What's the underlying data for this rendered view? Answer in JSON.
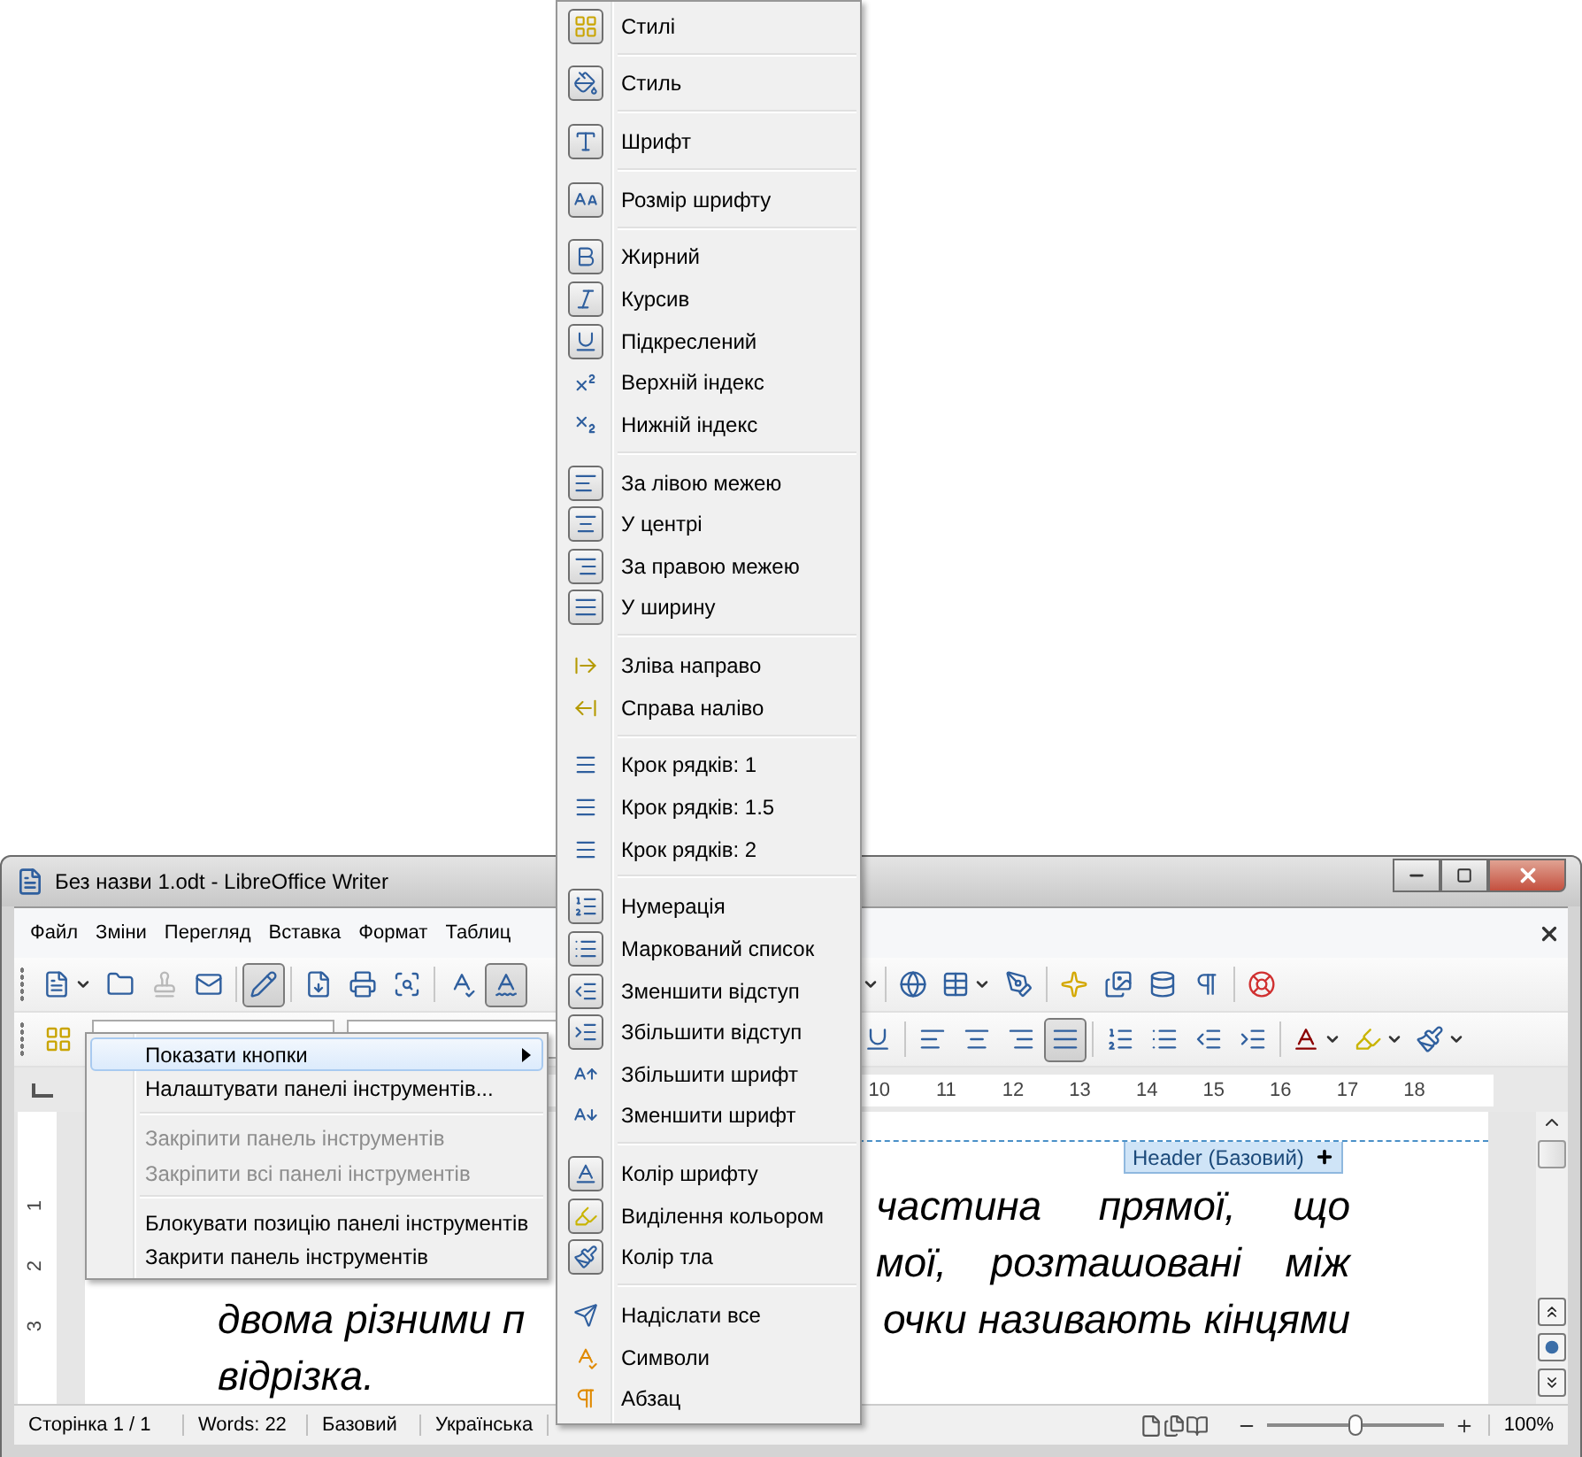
{
  "window": {
    "title": "Без назви 1.odt - LibreOffice Writer"
  },
  "menu_bar": [
    "Файл",
    "Зміни",
    "Перегляд",
    "Вставка",
    "Формат",
    "Таблиц"
  ],
  "standard_toolbar": {
    "left": [
      {
        "pressed": false,
        "dropdown": true,
        "disabled": false
      },
      {
        "pressed": false,
        "dropdown": false,
        "disabled": false
      },
      {
        "pressed": false,
        "dropdown": false,
        "disabled": true
      },
      {
        "pressed": false,
        "dropdown": false,
        "disabled": false
      },
      {
        "pressed": true,
        "dropdown": false,
        "disabled": false
      },
      {
        "pressed": false,
        "dropdown": false,
        "disabled": false
      },
      {
        "pressed": false,
        "dropdown": false,
        "disabled": false
      },
      {
        "pressed": false,
        "dropdown": false,
        "disabled": false
      },
      {
        "pressed": false,
        "dropdown": false,
        "disabled": false
      },
      {
        "pressed": true,
        "dropdown": false,
        "disabled": false
      }
    ],
    "right": [
      {
        "pressed": false,
        "dropdown": false,
        "disabled": false
      },
      {
        "pressed": false,
        "dropdown": true,
        "disabled": false
      },
      {
        "pressed": false,
        "dropdown": false,
        "disabled": false
      },
      {
        "pressed": false,
        "dropdown": false,
        "disabled": false
      },
      {
        "pressed": false,
        "dropdown": false,
        "disabled": false
      },
      {
        "pressed": false,
        "dropdown": false,
        "disabled": false
      },
      {
        "pressed": false,
        "dropdown": false,
        "disabled": false
      },
      {
        "pressed": false,
        "dropdown": false,
        "disabled": false
      }
    ]
  },
  "formatting_toolbar": {
    "right": [
      {
        "pressed": false,
        "dropdown": false
      },
      {
        "pressed": false,
        "dropdown": false
      },
      {
        "pressed": false,
        "dropdown": false
      },
      {
        "pressed": false,
        "dropdown": false
      },
      {
        "pressed": true,
        "dropdown": false
      },
      {
        "pressed": false,
        "dropdown": false
      },
      {
        "pressed": false,
        "dropdown": false
      },
      {
        "pressed": false,
        "dropdown": false
      },
      {
        "pressed": false,
        "dropdown": false
      },
      {
        "pressed": false,
        "dropdown": true
      },
      {
        "pressed": false,
        "dropdown": true
      },
      {
        "pressed": false,
        "dropdown": true
      }
    ]
  },
  "ruler": [
    "10",
    "11",
    "12",
    "13",
    "14",
    "15",
    "16",
    "17",
    "18"
  ],
  "vertical_ruler": [
    "1",
    "2",
    "3"
  ],
  "header_tag": "Header (Базовий)",
  "document_lines": [
    {
      "right": [
        "частина",
        "прямої,",
        "що"
      ]
    },
    {
      "right": [
        "мої,",
        "розташовані",
        "між"
      ]
    },
    {
      "left": "двома різними п",
      "right": [
        "очки називають кінцями"
      ]
    },
    {
      "left": "відрізка."
    }
  ],
  "status_bar": {
    "page": "Сторінка 1 / 1",
    "words": "Words: 22",
    "style": "Базовий",
    "language": "Українська",
    "zoom_slider": {
      "level": 0.5
    },
    "zoom": "100%"
  },
  "context_menu": {
    "groups": [
      {
        "items": [
          {
            "label": "Показати кнопки",
            "selected": true,
            "disabled": false,
            "submenu": true
          },
          {
            "label": "Налаштувати панелі інструментів...",
            "selected": false,
            "disabled": false,
            "submenu": false
          }
        ]
      },
      {
        "items": [
          {
            "label": "Закріпити панель інструментів",
            "selected": false,
            "disabled": true,
            "submenu": false
          },
          {
            "label": "Закріпити всі панелі інструментів",
            "selected": false,
            "disabled": true,
            "submenu": false
          }
        ]
      },
      {
        "items": [
          {
            "label": "Блокувати позицію панелі інструментів",
            "selected": false,
            "disabled": false,
            "submenu": false
          },
          {
            "label": "Закрити панель інструментів",
            "selected": false,
            "disabled": false,
            "submenu": false
          }
        ]
      }
    ]
  },
  "buttons_menu": {
    "groups": [
      {
        "items": [
          {
            "label": "Стилі",
            "checked": true
          }
        ]
      },
      {
        "items": [
          {
            "label": "Стиль",
            "checked": true
          }
        ]
      },
      {
        "items": [
          {
            "label": "Шрифт",
            "checked": true
          }
        ]
      },
      {
        "items": [
          {
            "label": "Розмір шрифту",
            "checked": true
          }
        ]
      },
      {
        "items": [
          {
            "label": "Жирний",
            "checked": true
          },
          {
            "label": "Курсив",
            "checked": true
          },
          {
            "label": "Підкреслений",
            "checked": true
          },
          {
            "label": "Верхній індекс",
            "checked": false
          },
          {
            "label": "Нижній індекс",
            "checked": false
          }
        ]
      },
      {
        "items": [
          {
            "label": "За лівою межею",
            "checked": true
          },
          {
            "label": "У центрі",
            "checked": true
          },
          {
            "label": "За правою межею",
            "checked": true
          },
          {
            "label": "У ширину",
            "checked": true
          }
        ]
      },
      {
        "items": [
          {
            "label": "Зліва направо",
            "checked": false
          },
          {
            "label": "Справа наліво",
            "checked": false
          }
        ]
      },
      {
        "items": [
          {
            "label": "Крок рядків: 1",
            "checked": false
          },
          {
            "label": "Крок рядків: 1.5",
            "checked": false
          },
          {
            "label": "Крок рядків: 2",
            "checked": false
          }
        ]
      },
      {
        "items": [
          {
            "label": "Нумерація",
            "checked": true
          },
          {
            "label": "Маркований список",
            "checked": true
          },
          {
            "label": "Зменшити відступ",
            "checked": true
          },
          {
            "label": "Збільшити відступ",
            "checked": true
          },
          {
            "label": "Збільшити шрифт",
            "checked": false
          },
          {
            "label": "Зменшити шрифт",
            "checked": false
          }
        ]
      },
      {
        "items": [
          {
            "label": "Колір шрифту",
            "checked": true
          },
          {
            "label": "Виділення кольором",
            "checked": true
          },
          {
            "label": "Колір тла",
            "checked": true
          }
        ]
      },
      {
        "items": [
          {
            "label": "Надіслати все",
            "checked": false
          },
          {
            "label": "Символи",
            "checked": false
          },
          {
            "label": "Абзац",
            "checked": false
          }
        ]
      }
    ]
  }
}
